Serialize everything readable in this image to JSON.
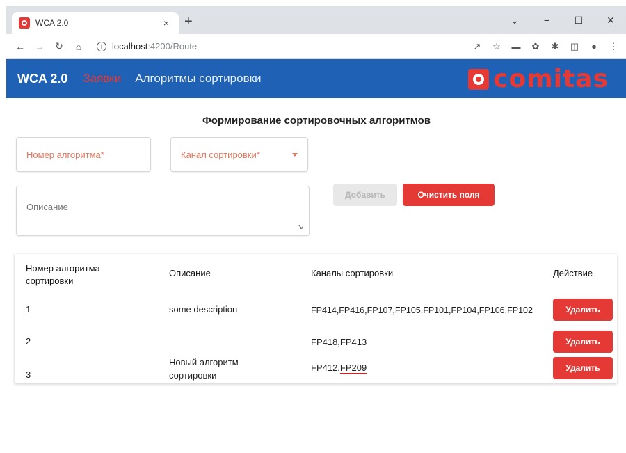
{
  "browser": {
    "tab_title": "WCA 2.0",
    "tab_close": "×",
    "new_tab": "+",
    "url_host": "localhost",
    "url_path": ":4200/Route",
    "win_min": "−",
    "win_max": "☐",
    "win_close": "✕",
    "win_chevron": "⌄"
  },
  "header": {
    "title": "WCA 2.0",
    "nav": [
      "Заявки",
      "Алгоритмы сортировки"
    ],
    "logo_text": "comitas",
    "accent_color": "#e53935",
    "bar_color": "#1f62b5"
  },
  "form": {
    "heading": "Формирование сортировочных алгоритмов",
    "algo_placeholder": "Номер алгоритма*",
    "channel_placeholder": "Канал сортировки*",
    "desc_placeholder": "Описание",
    "add_label": "Добавить",
    "clear_label": "Очистить поля"
  },
  "table": {
    "headers": {
      "number_line1": "Номер алгоритма",
      "number_line2": "сортировки",
      "description": "Описание",
      "channels": "Каналы сортировки",
      "action": "Действие"
    },
    "rows": [
      {
        "number": "1",
        "description": "some description",
        "description2": "",
        "channels": "FP414,FP416,FP107,FP105,FP101,FP104,FP106,FP102",
        "channels_a": "",
        "channels_b": "",
        "action": "Удалить"
      },
      {
        "number": "2",
        "description": "",
        "description2": "",
        "channels": "FP418,FP413",
        "channels_a": "",
        "channels_b": "",
        "action": "Удалить"
      },
      {
        "number": "3",
        "description": "Новый алгоритм",
        "description2": "сортировки",
        "channels": "",
        "channels_a": "FP412,",
        "channels_b": "FP209",
        "action": "Удалить"
      }
    ]
  }
}
